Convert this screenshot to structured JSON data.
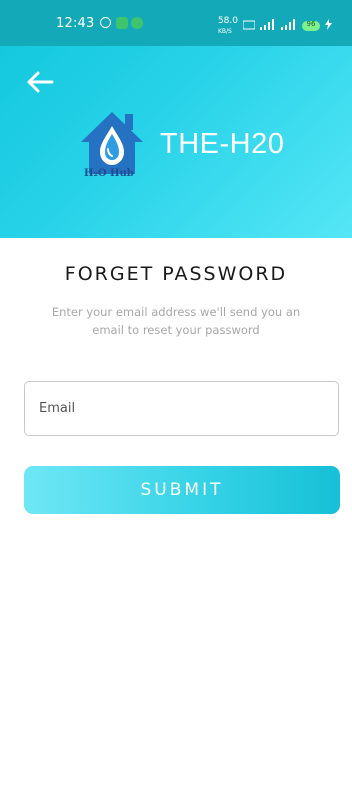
{
  "status_bar": {
    "time": "12:43",
    "network_speed": "58.0",
    "network_unit": "KB/S",
    "battery_level": "96"
  },
  "header": {
    "brand_title": "THE-H20",
    "logo_text": "H₂O Hub"
  },
  "page": {
    "title": "FORGET PASSWORD",
    "subtitle": "Enter your email address we'll send you an email to reset your password"
  },
  "form": {
    "email_placeholder": "Email",
    "email_value": "",
    "submit_label": "SUBMIT"
  },
  "colors": {
    "header_gradient_start": "#10c6dc",
    "header_gradient_end": "#55e6f6",
    "statusbar": "#13a9b8",
    "logo_blue": "#2672c2",
    "button_start": "#6fe7f5",
    "button_end": "#16c0d6"
  }
}
